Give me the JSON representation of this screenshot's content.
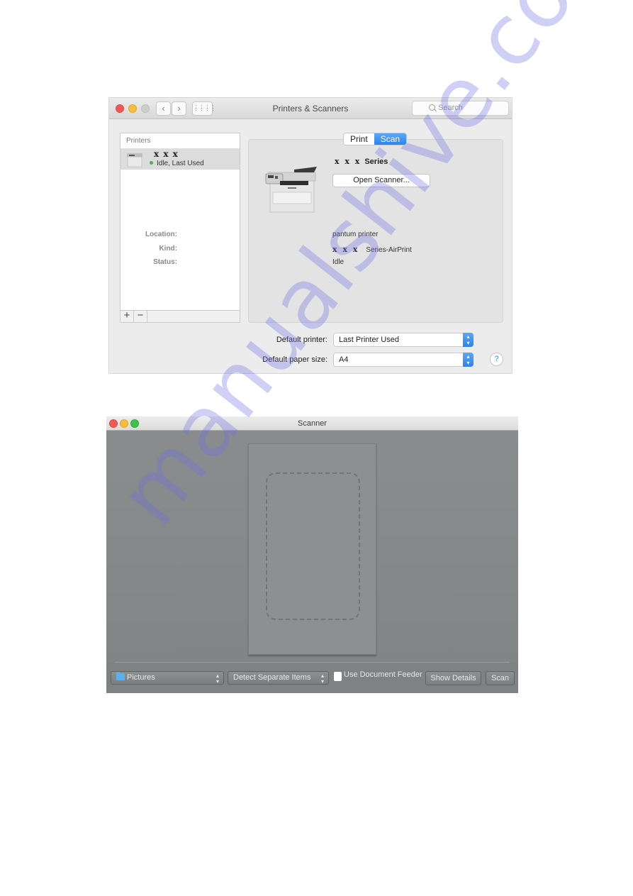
{
  "printers_window": {
    "title": "Printers & Scanners",
    "nav": {
      "back_icon": "chevron-left-icon",
      "forward_icon": "chevron-right-icon",
      "grid_icon": "grid-icon"
    },
    "search": {
      "placeholder": "Search"
    },
    "printer_list": {
      "header": "Printers",
      "items": [
        {
          "name": "x x x",
          "status": "Idle, Last Used",
          "status_color": "#3fb94c"
        }
      ],
      "add_label": "+",
      "remove_label": "−"
    },
    "tabs": [
      {
        "label": "Print",
        "selected": false
      },
      {
        "label": "Scan",
        "selected": true
      }
    ],
    "detail": {
      "model_prefix": "x x x",
      "model_suffix": "Series",
      "open_scanner_label": "Open Scanner...",
      "location_label": "Location:",
      "location_value": "pantum printer",
      "kind_label": "Kind:",
      "kind_prefix": "x x x",
      "kind_suffix": "Series-AirPrint",
      "status_label": "Status:",
      "status_value": "Idle"
    },
    "default_printer_label": "Default printer:",
    "default_printer_value": "Last Printer Used",
    "default_paper_label": "Default paper size:",
    "default_paper_value": "A4",
    "help_label": "?",
    "accent_color": "#2d83ee"
  },
  "scanner_window": {
    "title": "Scanner",
    "destination": "Pictures",
    "detect_mode": "Detect Separate Items",
    "use_feeder_label": "Use Document Feeder",
    "use_feeder_checked": false,
    "show_details_label": "Show Details",
    "scan_label": "Scan"
  },
  "watermark": "manualshive.com"
}
